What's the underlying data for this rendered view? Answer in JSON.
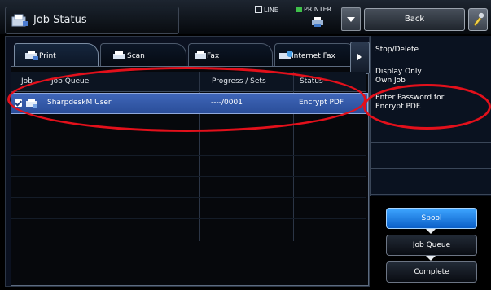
{
  "header": {
    "title": "Job Status",
    "line_label": "LINE",
    "printer_label": "PRINTER",
    "back_label": "Back"
  },
  "tabs": [
    {
      "label": "Print",
      "active": true
    },
    {
      "label": "Scan",
      "active": false
    },
    {
      "label": "Fax",
      "active": false
    },
    {
      "label": "Internet Fax",
      "active": false
    }
  ],
  "table": {
    "columns": [
      "Job",
      "Job Queue",
      "Progress / Sets",
      "Status"
    ],
    "rows": [
      {
        "job_queue": "SharpdeskM User",
        "progress": "----/0001",
        "status": "Encrypt PDF",
        "selected": true
      }
    ]
  },
  "side_menu": {
    "items": [
      "Stop/Delete",
      "Display Only Own Job",
      "Enter Password for Encrypt PDF.",
      "",
      "",
      ""
    ]
  },
  "mode_buttons": {
    "spool": "Spool",
    "job_queue": "Job Queue",
    "complete": "Complete"
  },
  "colors": {
    "selected_row": "#3f66b8",
    "annotation": "#e3101b",
    "active_mode": "#1a7ae0"
  }
}
